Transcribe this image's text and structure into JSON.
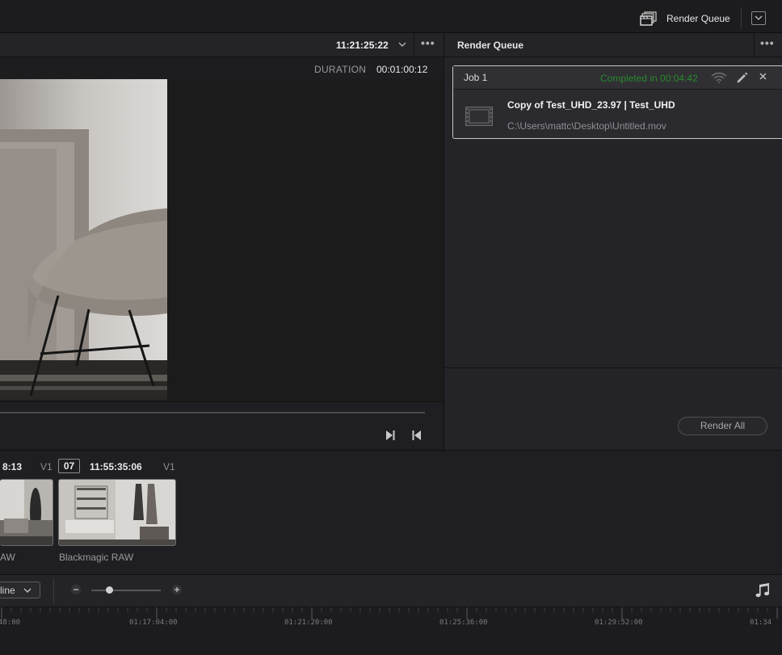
{
  "topbar": {
    "render_queue_label": "Render Queue"
  },
  "viewer": {
    "timecode": "11:21:25:22",
    "duration_label": "DURATION",
    "duration_value": "00:01:00:12"
  },
  "render_queue": {
    "title": "Render Queue",
    "job": {
      "name": "Job 1",
      "status": "Completed in 00:04:42",
      "title": "Copy of Test_UHD_23.97 | Test_UHD",
      "path": "C:\\Users\\mattc\\Desktop\\Untitled.mov"
    },
    "render_all_label": "Render All"
  },
  "media_pool": {
    "clips": [
      {
        "timecode": "8:13",
        "track": "V1",
        "label": "AW"
      },
      {
        "number": "07",
        "timecode": "11:55:35:06",
        "track": "V1",
        "label": "Blackmagic RAW"
      }
    ]
  },
  "timeline": {
    "view_select": "line",
    "ruler_labels": [
      "48:00",
      "01:17:04:00",
      "01:21:20:00",
      "01:25:36:00",
      "01:29:52:00",
      "01:34"
    ]
  },
  "colors": {
    "status_green": "#2a8a2a",
    "panel_bg": "#242428",
    "selection_border": "#c8c8c8"
  }
}
